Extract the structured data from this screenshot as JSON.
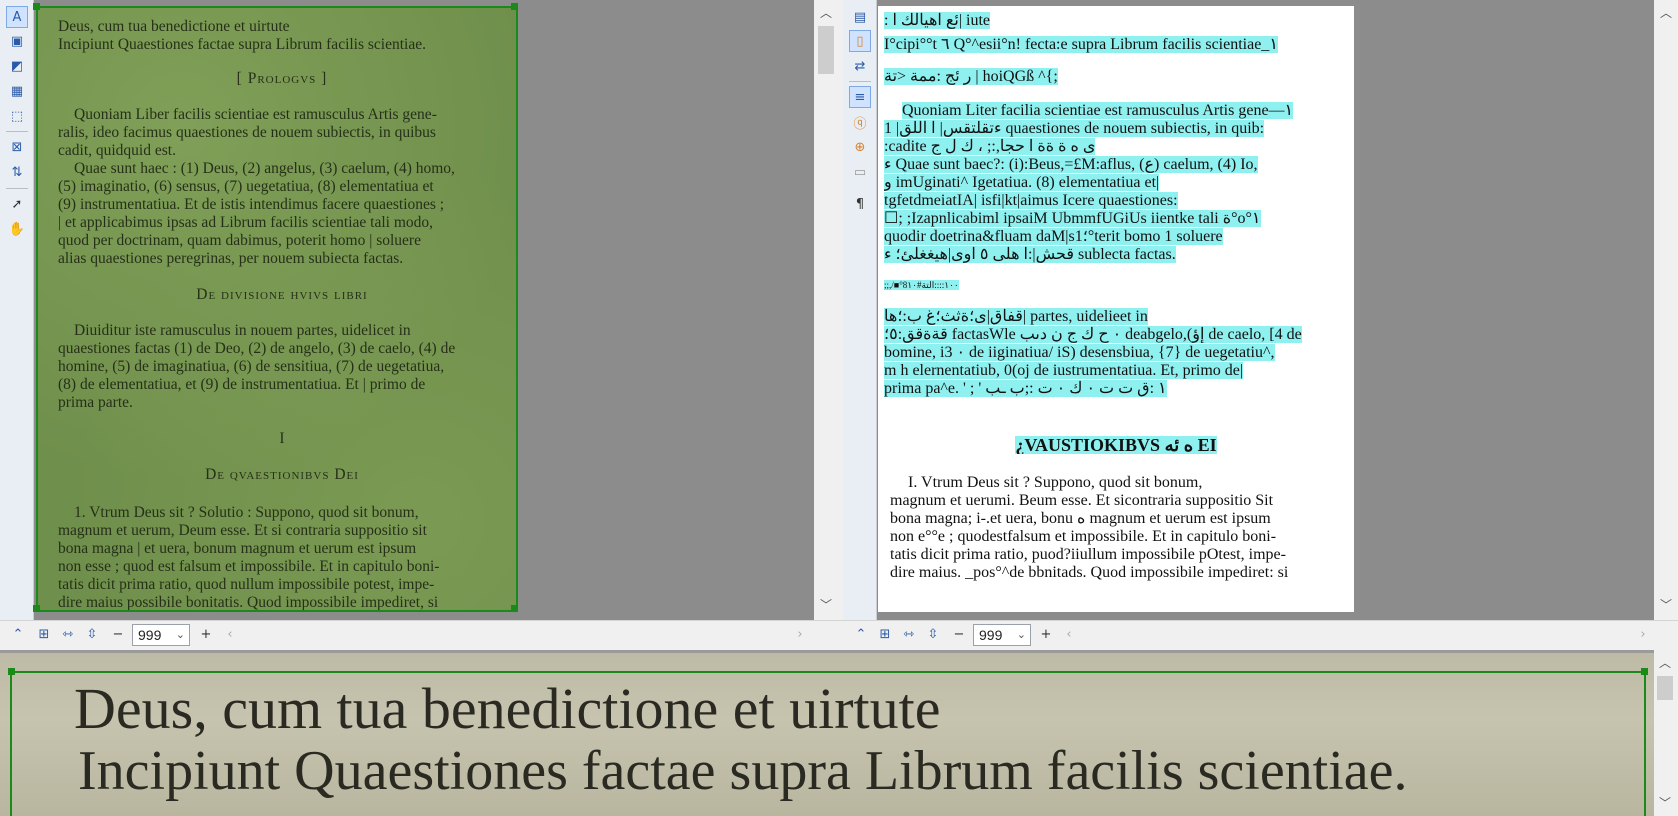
{
  "left_toolbar": {
    "icons": [
      "text-area-icon",
      "picture-area-icon",
      "background-picture-area-icon",
      "table-area-icon",
      "recognition-area-icon",
      "delete-area-icon",
      "order-areas-icon",
      "select-tool-icon",
      "pan-tool-icon"
    ]
  },
  "right_toolbar": {
    "icons": [
      "page-view-icon",
      "text-page-icon",
      "sync-view-icon",
      "text-properties-icon",
      "verify-text-icon",
      "find-icon",
      "mark-errors-icon",
      "pilcrow-icon"
    ]
  },
  "image_pane": {
    "lines": [
      {
        "text": "Deus, cum tua benedictione et uirtute",
        "align": "left"
      },
      {
        "text": "Incipiunt Quaestiones factae supra Librum facilis scientiae.",
        "align": "left"
      },
      {
        "text": "[ Prologvs ]",
        "align": "center"
      },
      {
        "text": "Quoniam Liber facilis scientiae est ramusculus Artis gene-",
        "align": "left"
      },
      {
        "text": "ralis, ideo facimus quaestiones de nouem subiectis, in quibus",
        "align": "left"
      },
      {
        "text": "cadit, quidquid est.",
        "align": "left"
      },
      {
        "text": "Quae sunt haec : (1) Deus, (2) angelus, (3) caelum, (4) homo,",
        "align": "left"
      },
      {
        "text": "(5) imaginatio, (6) sensus, (7) uegetatiua, (8) elementatiua et",
        "align": "left"
      },
      {
        "text": "(9) instrumentatiua. Et de istis intendimus facere quaestiones ;",
        "align": "left"
      },
      {
        "text": "| et applicabimus ipsas ad Librum facilis scientiae tali modo,",
        "align": "left"
      },
      {
        "text": "quod per doctrinam, quam dabimus, poterit homo | soluere",
        "align": "left"
      },
      {
        "text": "alias quaestiones peregrinas, per nouem subiecta factas.",
        "align": "left"
      },
      {
        "text": "De divisione hvivs libri",
        "align": "center"
      },
      {
        "text": "Diuiditur iste ramusculus in nouem partes, uidelicet in",
        "align": "left"
      },
      {
        "text": "quaestiones factas (1) de Deo, (2) de angelo, (3) de caelo, (4) de",
        "align": "left"
      },
      {
        "text": "homine, (5) de imaginatiua, (6) de sensitiua, (7) de uegetatiua,",
        "align": "left"
      },
      {
        "text": "(8) de elementatiua, et (9) de instrumentatiua. Et | primo de",
        "align": "left"
      },
      {
        "text": "prima parte.",
        "align": "left"
      },
      {
        "text": "I",
        "align": "center"
      },
      {
        "text": "De qvaestionibvs Dei",
        "align": "center"
      },
      {
        "text": "1. Vtrum Deus sit ? Solutio : Suppono, quod sit bonum,",
        "align": "left"
      },
      {
        "text": "magnum et uerum, Deum esse. Et si contraria suppositio sit",
        "align": "left"
      },
      {
        "text": "bona magna | et uera, bonum magnum et uerum est ipsum",
        "align": "left"
      },
      {
        "text": "non esse ; quod est falsum et impossibile. Et in capitulo boni-",
        "align": "left"
      },
      {
        "text": "tatis dicit prima ratio, quod nullum impossibile potest, impe-",
        "align": "left"
      },
      {
        "text": "dire maius possibile bonitatis. Quod impossibile impediret, si",
        "align": "left"
      }
    ]
  },
  "text_pane": {
    "lines": [
      ": ئع اهيالك ا| iute",
      "I°cipi°°t ٦ Q°^esii°n! fecta:e supra Librum facilis scientiae_١",
      "ر ئج :ممة <تة | hoiQGß ^{;",
      "Quoniam Liter facilia scientiae est ramusculus Artis gene—١",
      "ءتقلتقس| ا اللق| 1 quaestiones de nouem subiectis, in quib:",
      ":cadite ى ه ة ةة ا حجا,:; ، ك ل ج",
      "ء Quae sunt baec?: (i):Beus,=£M:aflus, (ع) caelum, (4) Io,",
      "و imUginati^  Igetatiua. (8) elementatiua et|",
      "tgfetdmeiatIA| isfi|kt|aimus Icere quaestiones:",
      "☐; ;Izapnlicabiml ipsaiM UbmmfUGiUs iientke tali ة°o°١",
      "quodir doetrina&fluam daM|s؛1°terit bomo 1 soluere",
      "قحش|:ا هلى ٥  اوى|هيغغلئ؛ ء  sublecta  factas.",
      ";;,/■°١٠٠::::التة#8١٠",
      "قفاق|ى؛ةثث؛غ  ب:؛ها|  partes,  uidelieet  in",
      "قةةقق:٥؛ factasWle ٠ ح ك ج ن دىب deabgelo,(إؤ de caelo, [4 de",
      "bomine, i3 ٠ de iiginatiua/ iS) desensbiua, {7} de uegetatiu^,",
      "m h elernentatiub, 0(oj de iustrumentatiua. Et, primo de|",
      "prima pa^e. ' ;  ' ١ :ق ت ت ٠ ك ٠ ت :;ب ـب",
      "¿VAUSTIOKIBVS ه ئه EI",
      "I. Vtrum Deus sit ? Suppono, quod sit bonum,",
      "magnum et uerumi. Beum esse. Et sicontraria suppositio Sit",
      "bona magna; i-.et uera, bonu ه magnum et uerum est ipsum",
      "non e°°e ; quodestfalsum et impossibile. Et in capitulo boni-",
      "tatis dicit prima ratio, puod?iiullum impossibile pOtest, impe-",
      "dire maius. _pos°^de bbnitads. Quod impossibile impediret: si"
    ]
  },
  "zoom_bars": {
    "left_value": "999",
    "right_value": "999"
  },
  "zoom_view": {
    "lines": [
      "Deus, cum tua benedictione et uirtute",
      "Incipiunt Quaestiones factae supra Librum facilis scientiae."
    ]
  }
}
